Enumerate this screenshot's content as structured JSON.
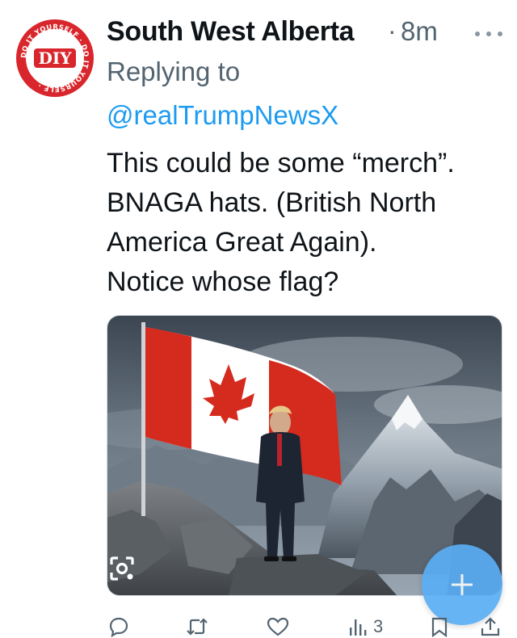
{
  "post": {
    "author": {
      "name": "South West Alberta",
      "avatar": {
        "logo_text": "DIY",
        "ring_text": "DO IT YOURSELF · DO IT YOURSELF ·",
        "ring_color": "#d8262c"
      }
    },
    "separator": "·",
    "timestamp": "8m",
    "replying_to_label": "Replying to",
    "replying_to_handle": "@realTrumpNewsX",
    "text_lines": [
      "This could be some “merch”.",
      "BNAGA hats.  (British North",
      "America Great Again).",
      "Notice whose flag?"
    ],
    "media": {
      "alt": "Man in suit standing on mountain rocks beside a Canadian flag",
      "flag_colors": {
        "red": "#d52b1e",
        "white": "#ffffff"
      }
    },
    "actions": {
      "reply_icon": "reply-icon",
      "repost_icon": "repost-icon",
      "like_icon": "like-icon",
      "views_icon": "views-icon",
      "views_count": "3",
      "bookmark_icon": "bookmark-icon",
      "share_icon": "share-icon"
    }
  },
  "compose_fab": {
    "icon": "plus-icon",
    "color": "#5aaef4"
  },
  "lens_icon": "visual-search-icon",
  "colors": {
    "text_primary": "#0f1419",
    "text_secondary": "#536471",
    "link": "#1d9bf0"
  }
}
